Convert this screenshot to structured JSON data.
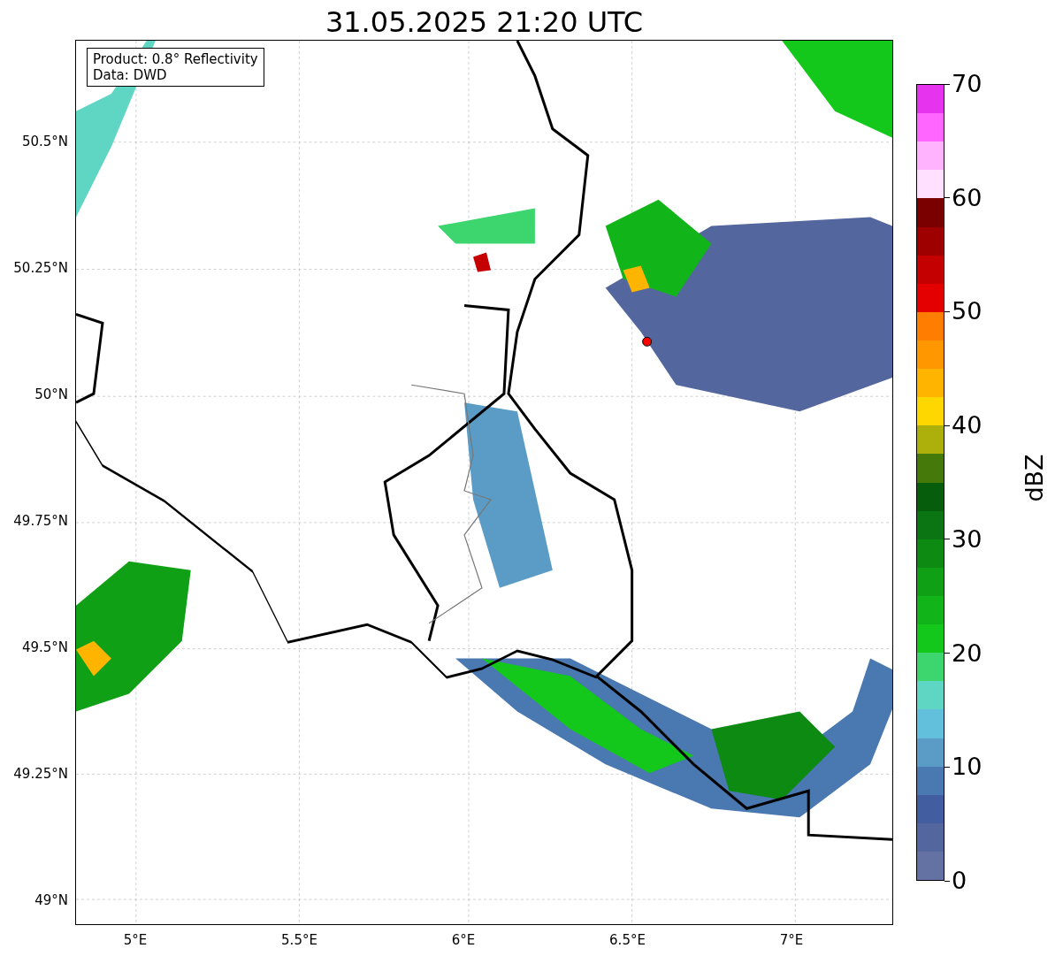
{
  "title": "31.05.2025 21:20 UTC",
  "legend": {
    "lines": [
      "Product: 0.8° Reflectivity",
      "Data: DWD"
    ]
  },
  "map": {
    "y_ticks": [
      "50.5°N",
      "50.25°N",
      "50°N",
      "49.75°N",
      "49.5°N",
      "49.25°N",
      "49°N"
    ],
    "x_ticks": [
      "5°E",
      "5.5°E",
      "6°E",
      "6.5°E",
      "7°E"
    ]
  },
  "colorbar": {
    "label": "dBZ",
    "ticks": [
      "70",
      "60",
      "50",
      "40",
      "30",
      "20",
      "10",
      "0"
    ],
    "segments": [
      {
        "color": "#e633ee"
      },
      {
        "color": "#ff66ff"
      },
      {
        "color": "#ffb3ff"
      },
      {
        "color": "#ffe0ff"
      },
      {
        "color": "#7a0000"
      },
      {
        "color": "#9e0000"
      },
      {
        "color": "#c40000"
      },
      {
        "color": "#e40000"
      },
      {
        "color": "#ff7d00"
      },
      {
        "color": "#ff9700"
      },
      {
        "color": "#ffb400"
      },
      {
        "color": "#ffd700"
      },
      {
        "color": "#adb00a"
      },
      {
        "color": "#457a0b"
      },
      {
        "color": "#065e0c"
      },
      {
        "color": "#0a7512"
      },
      {
        "color": "#0c8a12"
      },
      {
        "color": "#10a015"
      },
      {
        "color": "#11b51a"
      },
      {
        "color": "#13c81a"
      },
      {
        "color": "#3cd56e"
      },
      {
        "color": "#5ed6c3"
      },
      {
        "color": "#63c0dc"
      },
      {
        "color": "#5a9cc5"
      },
      {
        "color": "#4a78b0"
      },
      {
        "color": "#435ea0"
      },
      {
        "color": "#53679e"
      },
      {
        "color": "#6371a3"
      }
    ]
  }
}
